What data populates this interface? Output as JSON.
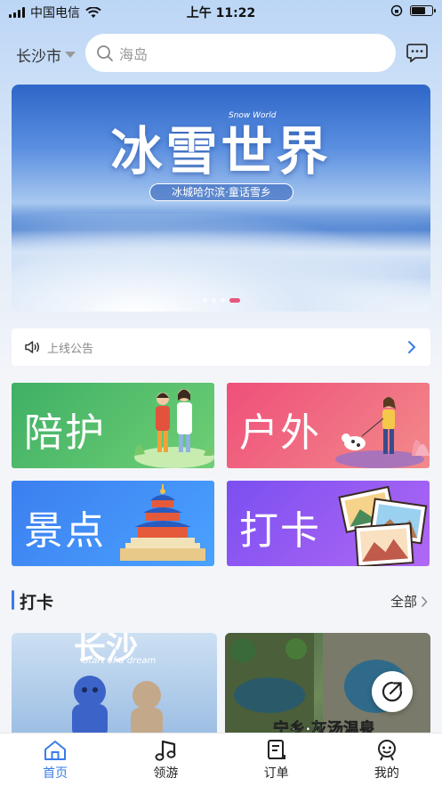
{
  "status_bar": {
    "carrier": "中国电信",
    "time": "上午 11:22"
  },
  "header": {
    "city": "长沙市",
    "search_placeholder": "海岛"
  },
  "banner": {
    "title": "冰雪世界",
    "title_en": "Snow World",
    "subtitle": "冰城哈尔滨·童话雪乡"
  },
  "notice": {
    "text": "上线公告"
  },
  "tiles": [
    {
      "label": "陪护"
    },
    {
      "label": "户外"
    },
    {
      "label": "景点"
    },
    {
      "label": "打卡"
    }
  ],
  "section": {
    "title": "打卡",
    "more": "全部"
  },
  "cards": [
    {
      "title": "长沙",
      "script": "Start of a dream"
    },
    {
      "title": "宁乡·灰汤温泉"
    }
  ],
  "tabbar": [
    {
      "label": "首页",
      "active": true
    },
    {
      "label": "领游"
    },
    {
      "label": "订单"
    },
    {
      "label": "我的"
    }
  ],
  "colors": {
    "accent": "#3a7bea",
    "banner_dot": "#e8577c"
  }
}
